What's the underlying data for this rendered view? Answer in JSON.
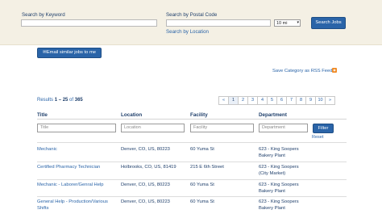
{
  "search": {
    "keyword_label": "Search by Keyword",
    "keyword_value": "",
    "postal_label": "Search by Postal Code",
    "postal_value": "",
    "radius_value": "10 mi",
    "search_button": "Search Jobs",
    "location_link": "Search by Location"
  },
  "actions": {
    "email_button": "Email similar jobs to me",
    "rss_link": "Save Category as RSS Feed",
    "rss_icon": "rss-icon"
  },
  "results": {
    "prefix": "Results",
    "range": "1 – 25",
    "of_word": "of",
    "total": "365"
  },
  "pagination": {
    "prev": "«",
    "pages": [
      "1",
      "2",
      "3",
      "4",
      "5",
      "6",
      "7",
      "8",
      "9",
      "10"
    ],
    "next": "»",
    "current": "1"
  },
  "table": {
    "columns": [
      "Title",
      "Location",
      "Facility",
      "Department"
    ],
    "filter_placeholders": [
      "Title",
      "Location",
      "Facility",
      "Department"
    ],
    "filter_button": "Filter",
    "reset_link": "Reset",
    "rows": [
      {
        "title": "Mechanic",
        "location": "Denver, CO, US, 80223",
        "facility": "60 Yuma St",
        "department": "623 - King Soopers Bakery Plant"
      },
      {
        "title": "Certified Pharmacy Technician",
        "location": "Holbrooks, CO, US, 81419",
        "facility": "215 E 6th Street",
        "department": "623 - King Soopers (City Market)"
      },
      {
        "title": "Mechanic - Laborer/Genral Help",
        "location": "Denver, CO, US, 80223",
        "facility": "60 Yuma St",
        "department": "623 - King Soopers Bakery Plant"
      },
      {
        "title": "General Help - Production/Various Shifts",
        "location": "Denver, CO, US, 80223",
        "facility": "60 Yuma St",
        "department": "623 - King Soopers Bakery Plant"
      }
    ]
  },
  "colors": {
    "band": "#f4f0e4",
    "link": "#2a64a8",
    "heading": "#1f3f6b",
    "button": "#2a64a8"
  }
}
